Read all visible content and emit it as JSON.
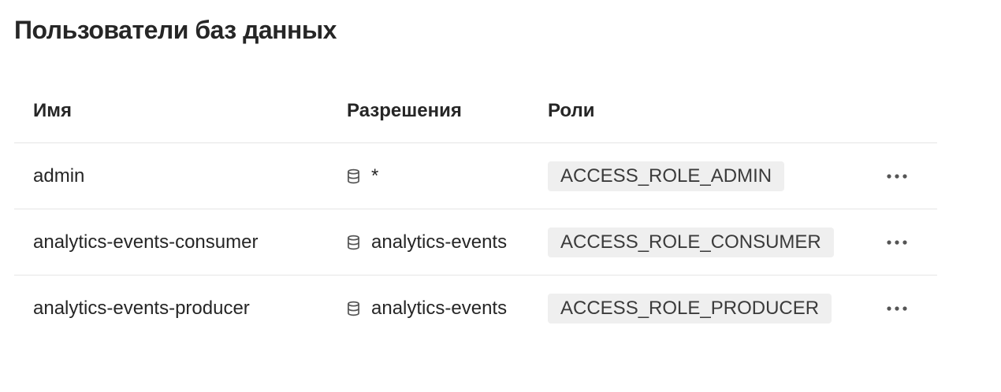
{
  "page": {
    "title": "Пользователи баз данных"
  },
  "table": {
    "columns": {
      "name": "Имя",
      "permissions": "Разрешения",
      "roles": "Роли"
    },
    "rows": [
      {
        "name": "admin",
        "permission": "*",
        "permission_icon": "database-icon",
        "role": "ACCESS_ROLE_ADMIN",
        "actions_icon": "more-horizontal-icon"
      },
      {
        "name": "analytics-events-consumer",
        "permission": "analytics-events",
        "permission_icon": "database-icon",
        "role": "ACCESS_ROLE_CONSUMER",
        "actions_icon": "more-horizontal-icon"
      },
      {
        "name": "analytics-events-producer",
        "permission": "analytics-events",
        "permission_icon": "database-icon",
        "role": "ACCESS_ROLE_PRODUCER",
        "actions_icon": "more-horizontal-icon"
      }
    ]
  },
  "colors": {
    "text": "#262626",
    "badge_background": "#efefef",
    "divider": "#e5e5e5",
    "icon": "#555555"
  }
}
